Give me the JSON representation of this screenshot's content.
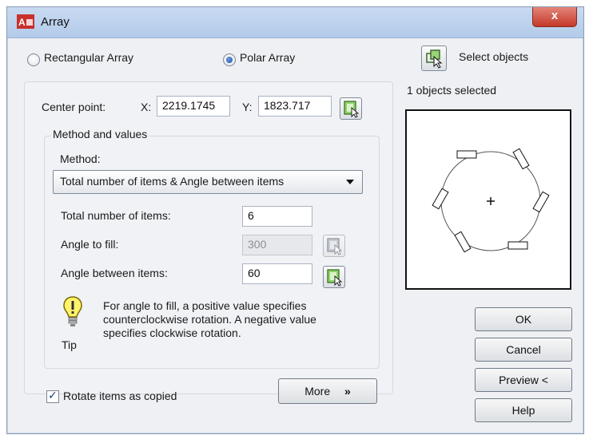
{
  "window": {
    "title": "Array",
    "close_label": "x"
  },
  "array_type": {
    "rectangular_label": "Rectangular Array",
    "polar_label": "Polar Array",
    "selected": "polar"
  },
  "select_objects": {
    "label": "Select objects",
    "status": "1 objects selected"
  },
  "center_point": {
    "label": "Center point:",
    "x_label": "X:",
    "x_value": "2219.1745",
    "y_label": "Y:",
    "y_value": "1823.717"
  },
  "method_group": {
    "title": "Method and values",
    "method_label": "Method:",
    "method_value": "Total number of items & Angle between items",
    "total_items_label": "Total number of items:",
    "total_items_value": "6",
    "angle_fill_label": "Angle to fill:",
    "angle_fill_value": "300",
    "angle_between_label": "Angle between items:",
    "angle_between_value": "60"
  },
  "tip": {
    "label": "Tip",
    "text_line1": "For angle to fill, a positive value specifies",
    "text_line2": "counterclockwise rotation.  A negative value",
    "text_line3": "specifies clockwise rotation."
  },
  "rotate_items": {
    "label": "Rotate items as copied",
    "checked": true
  },
  "more_button": {
    "label": "More",
    "icon": "double-chevron-down-icon"
  },
  "buttons": {
    "ok": "OK",
    "cancel": "Cancel",
    "preview": "Preview <",
    "help": "Help"
  },
  "colors": {
    "accent_green": "#6aa84f",
    "titlebar": "#b3cbe9",
    "close_red": "#c4382a"
  }
}
